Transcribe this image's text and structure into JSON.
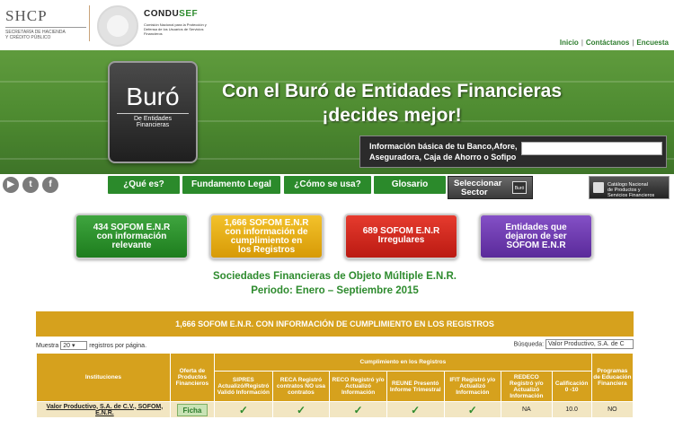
{
  "header": {
    "shcp_title": "SHCP",
    "shcp_sub1": "SECRETARÍA DE HACIENDA",
    "shcp_sub2": "Y CRÉDITO PÚBLICO",
    "condusef_title_a": "CONDU",
    "condusef_title_b": "SEF",
    "condusef_sub": "Comisión Nacional para la Protección y Defensa de los Usuarios de Servicios Financieros",
    "links": [
      "Inicio",
      "Contáctanos",
      "Encuesta"
    ]
  },
  "banner": {
    "buro_word": "Buró",
    "buro_sub": "De Entidades Financieras",
    "title_line1": "Con el Buró de Entidades Financieras",
    "title_line2": "¡decides mejor!",
    "search_label_line1": "Información básica de tu Banco,Afore,",
    "search_label_line2": "Aseguradora, Caja de Ahorro o Sofipo",
    "search_value": ""
  },
  "social": [
    "youtube-icon",
    "twitter-icon",
    "facebook-icon"
  ],
  "nav": {
    "items": [
      "¿Qué es?",
      "Fundamento Legal",
      "¿Cómo se usa?",
      "Glosario"
    ],
    "select_sector_line1": "Seleccionar",
    "select_sector_line2": "Sector",
    "select_sector_mini": "Buró",
    "catalogo_line1": "Catálogo Nacional",
    "catalogo_line2": "de Productos y",
    "catalogo_line3": "Servicios Financieros"
  },
  "categories": [
    {
      "line1": "434 SOFOM E.N.R",
      "line2": "con información",
      "line3": "relevante",
      "color": "#2a902a"
    },
    {
      "line1": "1,666 SOFOM E.N.R",
      "line2": "con información de",
      "line3": "cumplimiento en",
      "line4": "los Registros",
      "color": "#e8ad12"
    },
    {
      "line1": "689 SOFOM E.N.R",
      "line2": "Irregulares",
      "color": "#d42a1f"
    },
    {
      "line1": "Entidades que",
      "line2": "dejaron de ser",
      "line3": "SOFOM E.N.R",
      "color": "#6e3cb0"
    }
  ],
  "section": {
    "title": "Sociedades Financieras de Objeto Múltiple E.N.R.",
    "period": "Periodo: Enero – Septiembre 2015"
  },
  "table": {
    "heading": "1,666 SOFOM E.N.R. CON INFORMACIÓN DE CUMPLIMIENTO EN LOS REGISTROS",
    "show_prefix": "Muestra",
    "show_value": "20",
    "show_suffix": "registros por página.",
    "search_label": "Búsqueda:",
    "search_value": "Valor Productivo, S.A. de C",
    "col_institutions": "Instituciones",
    "col_offer": "Oferta de Productos Financieros",
    "col_group": "Cumplimiento en los Registros",
    "col_programs": "Programas de Educación Financiera",
    "sub_columns": [
      "SIPRES Actualizó/Registró Validó Información",
      "RECA Registró contratos NO usa contratos",
      "RECO Registró y/o Actualizó Información",
      "REUNE Presentó Informe Trimestral",
      "IFIT Registró y/o Actualizó Información",
      "REDECO Registró y/o Actualizó Información",
      "Calificación 0 -10"
    ],
    "rows": [
      {
        "institution": "Valor Productivo, S.A. de C.V., SOFOM, E.N.R.",
        "offer": "Ficha",
        "sipres": "✓",
        "reca": "✓",
        "reco": "✓",
        "reune": "✓",
        "ifit": "✓",
        "redeco": "NA",
        "score": "10.0",
        "programs": "NO"
      }
    ]
  }
}
